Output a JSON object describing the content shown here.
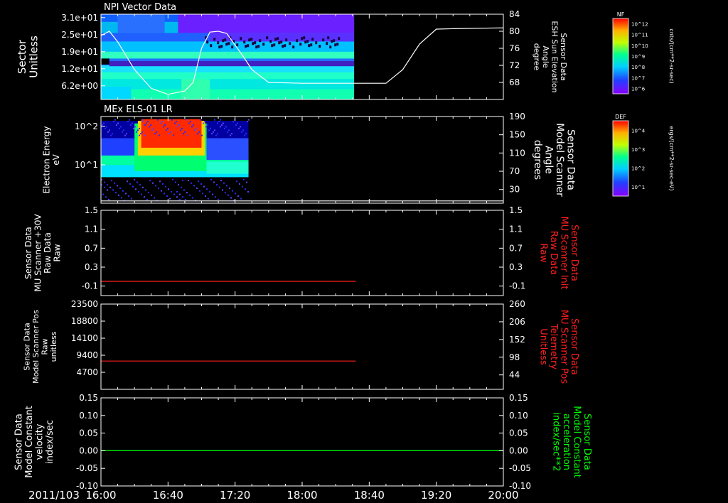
{
  "chart_data": [
    {
      "type": "heatmap",
      "title": "NPI Vector Data",
      "ylabel_left": [
        "Sector",
        "Unitless"
      ],
      "yticks_left": [
        "3.1e+01",
        "2.5e+01",
        "1.9e+01",
        "1.2e+01",
        "6.2e+00"
      ],
      "ylabel_right": [
        "Sensor Data",
        "ESH Sun Elevation",
        "Angle",
        "degree"
      ],
      "yticks_right": [
        "84",
        "80",
        "76",
        "72",
        "68"
      ],
      "ylim_right": [
        64,
        84
      ],
      "colorbar": {
        "label": "NF",
        "unit": "cnts/(cm**2-sr-sec)",
        "ticks": [
          "10^12",
          "10^11",
          "10^10",
          "10^9",
          "10^8",
          "10^7",
          "10^6"
        ]
      },
      "data_coverage_end": "18:31",
      "line_series": {
        "name": "ESH Sun Elevation Angle",
        "x": [
          "16:00",
          "16:05",
          "16:10",
          "16:20",
          "16:30",
          "16:40",
          "16:50",
          "16:55",
          "17:00",
          "17:05",
          "17:10",
          "17:15",
          "17:25",
          "17:30",
          "17:40",
          "18:00",
          "18:20",
          "18:40",
          "18:50",
          "19:00",
          "19:10",
          "19:20",
          "19:30",
          "20:00"
        ],
        "y": [
          79.0,
          80.0,
          77.5,
          71.0,
          66.6,
          65.2,
          66.0,
          68.0,
          76.0,
          79.8,
          80.0,
          79.5,
          74.0,
          71.0,
          68.0,
          67.8,
          67.8,
          67.8,
          67.8,
          71.0,
          77.0,
          80.5,
          80.6,
          80.8
        ]
      }
    },
    {
      "type": "heatmap",
      "title": "MEx ELS-01 LR",
      "ylabel_left": [
        "Electron Energy",
        "eV"
      ],
      "yticks_left": [
        "10^2",
        "10^1"
      ],
      "ylabel_right": [
        "Sensor Data",
        "Model Scanner",
        "Angle",
        "degrees"
      ],
      "yticks_right": [
        "190",
        "150",
        "110",
        "70",
        "30"
      ],
      "ylim_right": [
        0,
        190
      ],
      "colorbar": {
        "label": "DEF",
        "unit": "ergs/(cm**2-sr-sec-eV)",
        "ticks": [
          "10^4",
          "10^3",
          "10^2",
          "10^1"
        ]
      },
      "data_coverage": [
        "16:00",
        "17:28"
      ],
      "line_series": {
        "name": "Model Scanner Angle",
        "x": [
          "16:00",
          "20:00"
        ],
        "y": [
          5,
          5
        ]
      }
    },
    {
      "type": "line",
      "ylabel_left": [
        "Sensor Data",
        "MU Scanner +30V",
        "Raw Data",
        "Raw"
      ],
      "yticks_left": [
        "1.5",
        "1.1",
        "0.7",
        "0.3",
        "-0.1"
      ],
      "ylim_left": [
        -0.3,
        1.5
      ],
      "ylabel_right": [
        "Sensor Data",
        "MU Scanner Init",
        "Raw Data",
        "Raw"
      ],
      "yticks_right": [
        "1.5",
        "1.1",
        "0.7",
        "0.3",
        "-0.1"
      ],
      "ylim_right": [
        -0.3,
        1.5
      ],
      "series": [
        {
          "color": "#ff2020",
          "x": [
            "16:00",
            "18:32"
          ],
          "y": [
            0.0,
            0.0
          ]
        }
      ]
    },
    {
      "type": "line",
      "ylabel_left": [
        "Sensor Data",
        "Model Scanner Pos",
        "Raw",
        "unitless"
      ],
      "yticks_left": [
        "23500",
        "18800",
        "14100",
        "9400",
        "4700"
      ],
      "ylim_left": [
        0,
        23500
      ],
      "ylabel_right": [
        "Sensor Data",
        "MU Scanner Pos",
        "Telemetry",
        "Unitless"
      ],
      "yticks_right": [
        "260",
        "206",
        "152",
        "98",
        "44"
      ],
      "ylim_right": [
        0,
        260
      ],
      "series": [
        {
          "color": "#ff2020",
          "x": [
            "16:00",
            "18:32"
          ],
          "y": [
            7800,
            7800
          ]
        }
      ]
    },
    {
      "type": "line",
      "ylabel_left": [
        "Sensor Data",
        "Model Constant",
        "velocity",
        "index/sec"
      ],
      "yticks_left": [
        "0.15",
        "0.10",
        "0.05",
        "0.00",
        "-0.05",
        "-0.10"
      ],
      "ylim_left": [
        -0.1,
        0.15
      ],
      "ylabel_right": [
        "Sensor Data",
        "Model Constant",
        "acceleration",
        "index/sec**2"
      ],
      "yticks_right": [
        "0.15",
        "0.10",
        "0.05",
        "0.00",
        "-0.05",
        "-0.10"
      ],
      "ylim_right": [
        -0.1,
        0.15
      ],
      "series": [
        {
          "color": "#00ff00",
          "x": [
            "16:00",
            "20:00"
          ],
          "y": [
            0.0,
            0.0
          ]
        }
      ]
    }
  ],
  "time_axis": {
    "date_label": "2011/103",
    "ticks": [
      "16:00",
      "16:40",
      "17:20",
      "18:00",
      "18:40",
      "19:20",
      "20:00"
    ],
    "range": [
      "16:00",
      "20:00"
    ]
  },
  "colors": {
    "background": "#000000",
    "foreground": "#ffffff",
    "red_label": "#ff2020",
    "green_label": "#00ff00"
  }
}
